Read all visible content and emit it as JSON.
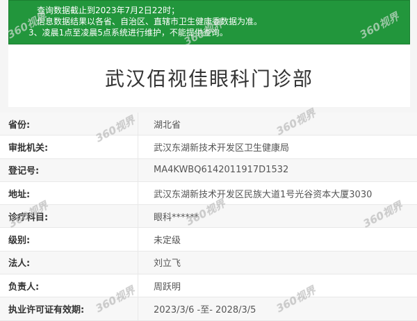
{
  "notice": {
    "lines": [
      "查询数据截止到2023年7月2日22时；",
      "信息数据结果以各省、自治区、直辖市卫生健康委数据为准。",
      "3、凌晨1点至凌晨5点系统进行维护，不能提供查询。"
    ]
  },
  "page_title": "武汉佰视佳眼科门诊部",
  "rows": [
    {
      "label": "省份:",
      "value": "湖北省"
    },
    {
      "label": "审批机关:",
      "value": "武汉东湖新技术开发区卫生健康局"
    },
    {
      "label": "登记号:",
      "value": "MA4KWBQ6142011917D1532"
    },
    {
      "label": "地址:",
      "value": "武汉东湖新技术开发区民族大道1号光谷资本大厦3030"
    },
    {
      "label": "诊疗科目:",
      "value": "眼科******"
    },
    {
      "label": "级别:",
      "value": "未定级"
    },
    {
      "label": "法人:",
      "value": "刘立飞"
    },
    {
      "label": "负责人:",
      "value": "周跃明"
    },
    {
      "label": "执业许可证有效期:",
      "value": "2023/3/6 -至- 2028/3/5"
    }
  ],
  "watermark": "360视界"
}
